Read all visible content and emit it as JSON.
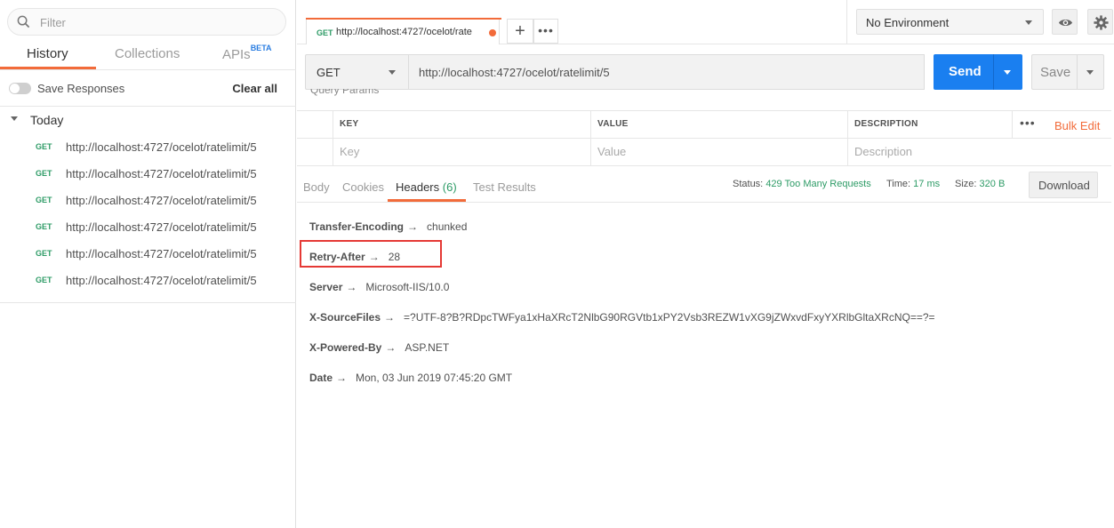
{
  "sidebar": {
    "filter_placeholder": "Filter",
    "tabs": [
      {
        "label": "History"
      },
      {
        "label": "Collections"
      },
      {
        "label": "APIs",
        "badge": "BETA"
      }
    ],
    "save_responses_label": "Save Responses",
    "clear_all_label": "Clear all",
    "group_label": "Today",
    "history": [
      {
        "method": "GET",
        "url": "http://localhost:4727/ocelot/ratelimit/5"
      },
      {
        "method": "GET",
        "url": "http://localhost:4727/ocelot/ratelimit/5"
      },
      {
        "method": "GET",
        "url": "http://localhost:4727/ocelot/ratelimit/5"
      },
      {
        "method": "GET",
        "url": "http://localhost:4727/ocelot/ratelimit/5"
      },
      {
        "method": "GET",
        "url": "http://localhost:4727/ocelot/ratelimit/5"
      },
      {
        "method": "GET",
        "url": "http://localhost:4727/ocelot/ratelimit/5"
      }
    ]
  },
  "request_tab": {
    "method": "GET",
    "url": "http://localhost:4727/ocelot/rate"
  },
  "environment": {
    "selected": "No Environment"
  },
  "request": {
    "method": "GET",
    "url": "http://localhost:4727/ocelot/ratelimit/5",
    "send_label": "Send",
    "save_label": "Save",
    "section_label": "Query Params"
  },
  "params": {
    "headers": [
      "KEY",
      "VALUE",
      "DESCRIPTION"
    ],
    "placeholders": [
      "Key",
      "Value",
      "Description"
    ],
    "bulk_edit_label": "Bulk Edit"
  },
  "response": {
    "tabs": {
      "body": "Body",
      "cookies": "Cookies",
      "headers": "Headers",
      "headers_count": "(6)",
      "tests": "Test Results"
    },
    "status_label": "Status:",
    "status_value": "429 Too Many Requests",
    "time_label": "Time:",
    "time_value": "17 ms",
    "size_label": "Size:",
    "size_value": "320 B",
    "download_label": "Download",
    "headers": [
      {
        "key": "Transfer-Encoding",
        "value": "chunked"
      },
      {
        "key": "Retry-After",
        "value": "28"
      },
      {
        "key": "Server",
        "value": "Microsoft-IIS/10.0"
      },
      {
        "key": "X-SourceFiles",
        "value": "=?UTF-8?B?RDpcTWFya1xHaXRcT2NlbG90RGVtb1xPY2Vsb3REZW1vXG9jZWxvdFxyYXRlbGltaXRcNQ==?="
      },
      {
        "key": "X-Powered-By",
        "value": "ASP.NET"
      },
      {
        "key": "Date",
        "value": "Mon, 03 Jun 2019 07:45:20 GMT"
      }
    ]
  },
  "colors": {
    "accent": "#f26b3a",
    "send": "#1a7ff0",
    "success_text": "#2d9b66",
    "highlight": "#e53935"
  }
}
